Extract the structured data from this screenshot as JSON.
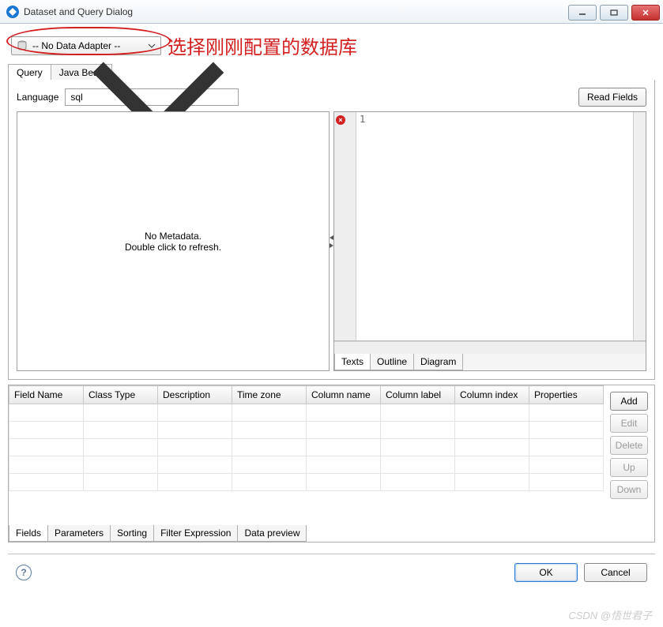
{
  "window": {
    "title": "Dataset and Query Dialog"
  },
  "adapter": {
    "selected": "-- No Data Adapter --"
  },
  "annotation": "选择刚刚配置的数据库",
  "outer_tabs": {
    "query": "Query",
    "java_bean": "Java Bean"
  },
  "language": {
    "label": "Language",
    "value": "sql"
  },
  "buttons": {
    "read_fields": "Read Fields",
    "add": "Add",
    "edit": "Edit",
    "delete": "Delete",
    "up": "Up",
    "down": "Down",
    "ok": "OK",
    "cancel": "Cancel",
    "help": "?"
  },
  "metadata_msg": {
    "l1": "No Metadata.",
    "l2": "Double click to refresh."
  },
  "editor": {
    "line1": "1"
  },
  "right_tabs": {
    "texts": "Texts",
    "outline": "Outline",
    "diagram": "Diagram"
  },
  "table": {
    "headers": [
      "Field Name",
      "Class Type",
      "Description",
      "Time zone",
      "Column name",
      "Column label",
      "Column index",
      "Properties"
    ]
  },
  "fields_tabs": {
    "fields": "Fields",
    "parameters": "Parameters",
    "sorting": "Sorting",
    "filter": "Filter Expression",
    "preview": "Data preview"
  },
  "watermark": "CSDN @悟世君子"
}
